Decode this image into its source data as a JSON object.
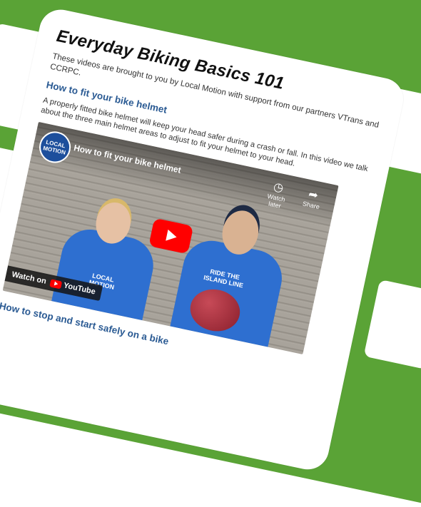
{
  "page": {
    "title": "Everyday Biking Basics 101",
    "intro": "These videos are brought to you by Local Motion with support from our partners VTrans and CCRPC."
  },
  "sections": [
    {
      "heading": "How to fit your bike helmet",
      "description": "A properly fitted bike helmet will keep your head safer during a crash or fall. In this video we talk about the three main helmet areas to adjust to fit your helmet to your head.",
      "video": {
        "title": "How to fit your bike helmet",
        "channel_logo_text": "LOCAL MOTION",
        "watch_later_label": "Watch later",
        "share_label": "Share",
        "watch_on_label": "Watch on",
        "youtube_label": "YouTube",
        "shirt_left_text": "LOCAL MOTION",
        "shirt_right_text": "RIDE THE ISLAND LINE"
      }
    },
    {
      "heading": "How to stop and start safely on a bike"
    }
  ],
  "colors": {
    "background_green": "#5aa336",
    "link_blue": "#2a5a93",
    "youtube_red": "#ff0000"
  }
}
